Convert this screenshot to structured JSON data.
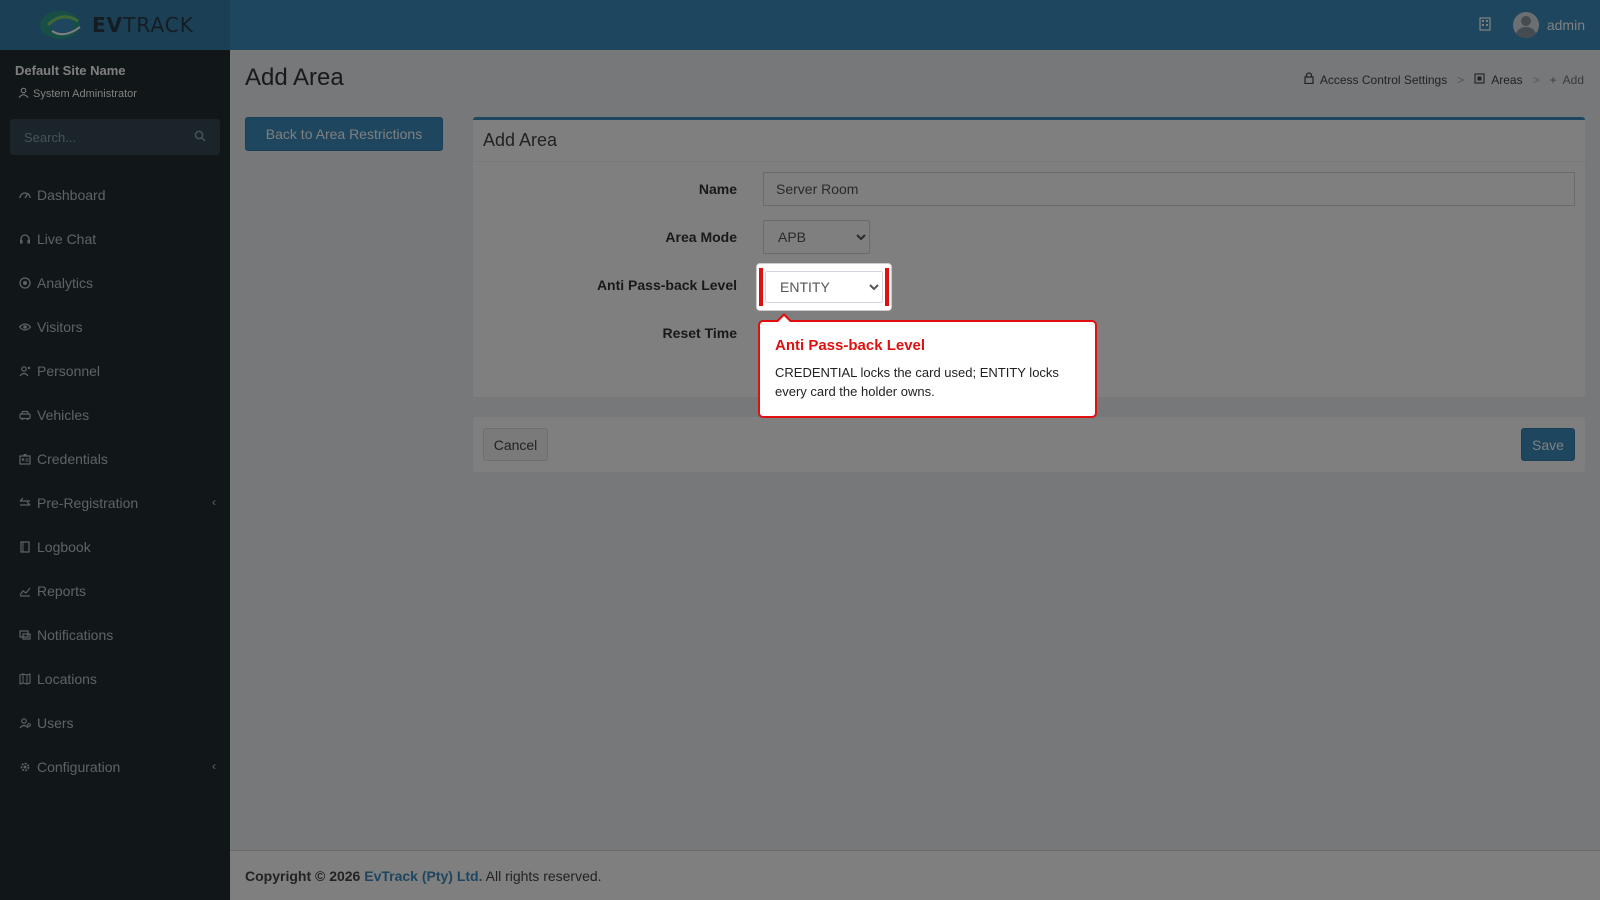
{
  "header": {
    "brand": "EVTRACK",
    "user_name": "admin"
  },
  "sidebar": {
    "site_name": "Default Site Name",
    "role": "System Administrator",
    "search_placeholder": "Search...",
    "items": [
      {
        "label": "Dashboard",
        "icon": "dashboard-icon"
      },
      {
        "label": "Live Chat",
        "icon": "headset-icon"
      },
      {
        "label": "Analytics",
        "icon": "analytics-icon"
      },
      {
        "label": "Visitors",
        "icon": "eye-icon"
      },
      {
        "label": "Personnel",
        "icon": "personnel-icon"
      },
      {
        "label": "Vehicles",
        "icon": "car-icon"
      },
      {
        "label": "Credentials",
        "icon": "id-card-icon"
      },
      {
        "label": "Pre-Registration",
        "icon": "arrows-icon",
        "has_submenu": true
      },
      {
        "label": "Logbook",
        "icon": "book-icon"
      },
      {
        "label": "Reports",
        "icon": "chart-icon"
      },
      {
        "label": "Notifications",
        "icon": "bell-icon"
      },
      {
        "label": "Locations",
        "icon": "map-icon"
      },
      {
        "label": "Users",
        "icon": "users-icon"
      },
      {
        "label": "Configuration",
        "icon": "gear-icon",
        "has_submenu": true
      }
    ]
  },
  "page": {
    "title": "Add Area",
    "breadcrumb": [
      "Access Control Settings",
      "Areas",
      "Add"
    ],
    "back_button": "Back to Area Restrictions"
  },
  "form": {
    "box_title": "Add Area",
    "name_label": "Name",
    "name_value": "Server Room",
    "area_mode_label": "Area Mode",
    "area_mode_value": "APB",
    "apb_level_label": "Anti Pass-back Level",
    "apb_level_value": "ENTITY",
    "reset_time_label": "Reset Time",
    "cancel_label": "Cancel",
    "save_label": "Save"
  },
  "tooltip": {
    "title": "Anti Pass-back Level",
    "body": "CREDENTIAL locks the card used; ENTITY locks every card the holder owns."
  },
  "footer": {
    "copyright_prefix": "Copyright © 2026",
    "company": "EvTrack (Pty) Ltd.",
    "suffix": "All rights reserved."
  },
  "colors": {
    "primary": "#3c8dbc",
    "sidebar": "#222d32",
    "highlight": "#e01010"
  }
}
